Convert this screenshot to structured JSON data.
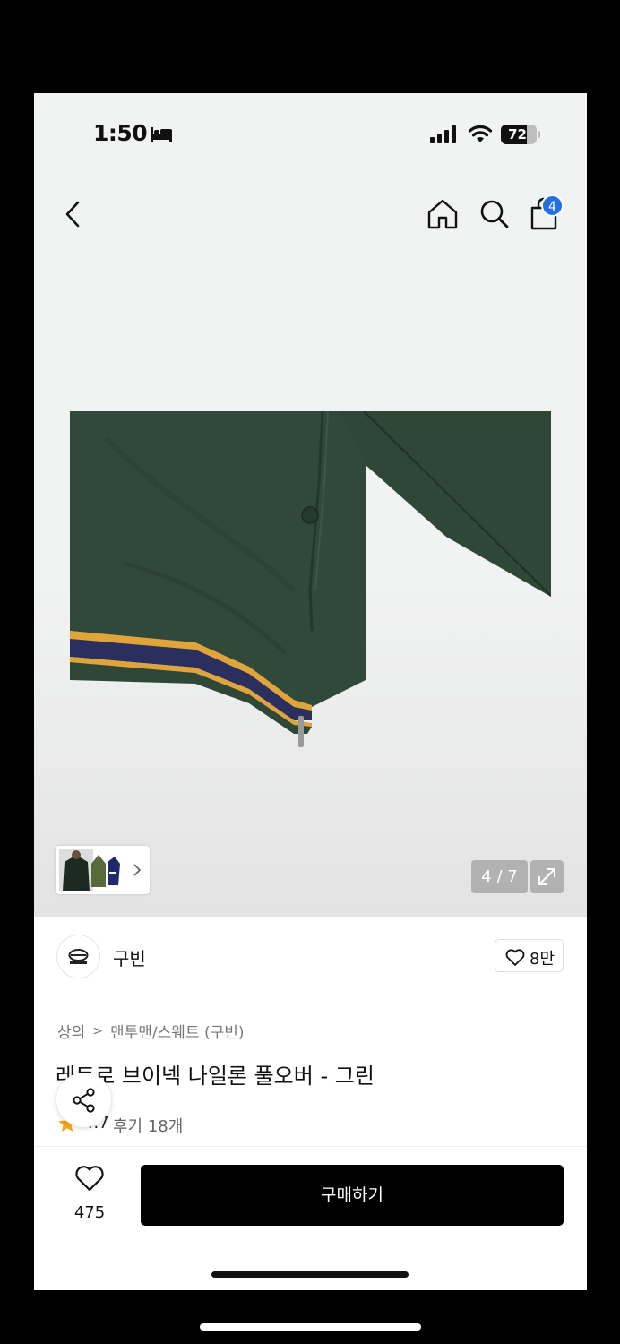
{
  "status_bar": {
    "time": "1:50",
    "battery": "72",
    "battery_level": 0.72
  },
  "nav": {
    "cart_count": "4"
  },
  "gallery": {
    "counter": "4 / 7"
  },
  "brand": {
    "name": "구빈",
    "likes": "8만"
  },
  "breadcrumb": {
    "category": "상의",
    "subcategory": "맨투맨/스웨트 (구빈)"
  },
  "product": {
    "title": "레트로 브이넥 나일론 풀오버 - 그린",
    "rating": "4.7",
    "reviews": "후기 18개"
  },
  "bottom_bar": {
    "like_count": "475",
    "buy_label": "구매하기"
  },
  "colors": {
    "accent_badge": "#1f6fe6",
    "jacket_green": "#2f4a33",
    "rib_navy": "#2a2f5e",
    "rib_gold": "#e0a53a",
    "star": "#f7a41d"
  }
}
